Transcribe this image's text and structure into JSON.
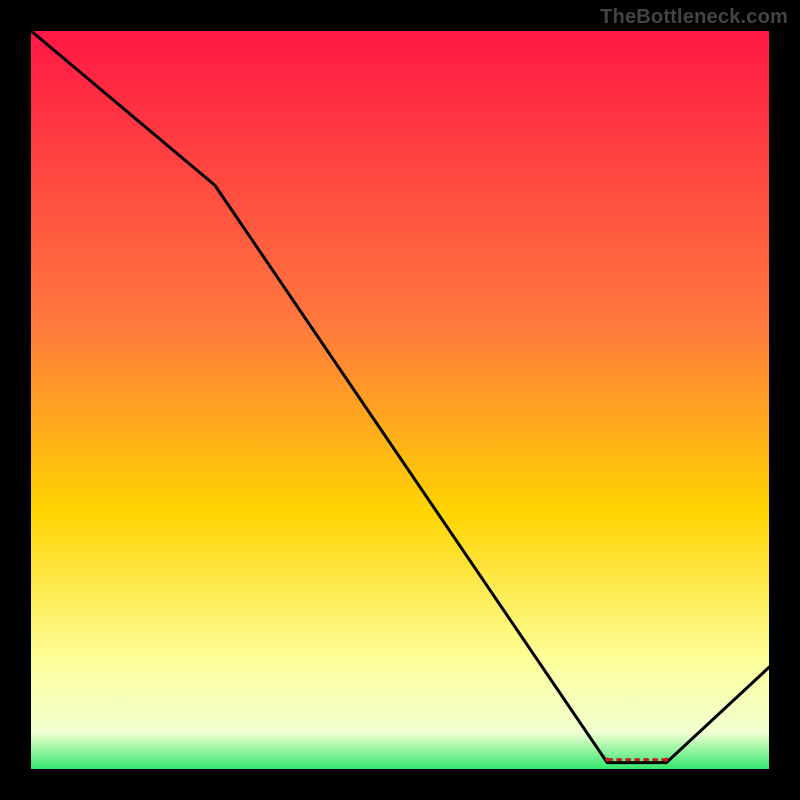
{
  "watermark": "TheBottleneck.com",
  "series_label": "",
  "chart_data": {
    "type": "line",
    "title": "",
    "xlabel": "",
    "ylabel": "",
    "xlim": [
      0,
      100
    ],
    "ylim": [
      0,
      100
    ],
    "grid": false,
    "legend_position": "none",
    "background_gradient_stops": [
      {
        "offset": 0.0,
        "color": "#ff1744"
      },
      {
        "offset": 0.4,
        "color": "#ff7a3d"
      },
      {
        "offset": 0.65,
        "color": "#ffd400"
      },
      {
        "offset": 0.85,
        "color": "#feff9a"
      },
      {
        "offset": 0.95,
        "color": "#f0ffd0"
      },
      {
        "offset": 1.0,
        "color": "#2ee66a"
      }
    ],
    "series": [
      {
        "name": "curve",
        "color": "#000000",
        "x": [
          0,
          25,
          78,
          86,
          100
        ],
        "y": [
          100,
          79,
          1,
          1,
          14
        ]
      }
    ],
    "flat_segment": {
      "x_start": 78,
      "x_end": 86,
      "y": 1
    }
  }
}
